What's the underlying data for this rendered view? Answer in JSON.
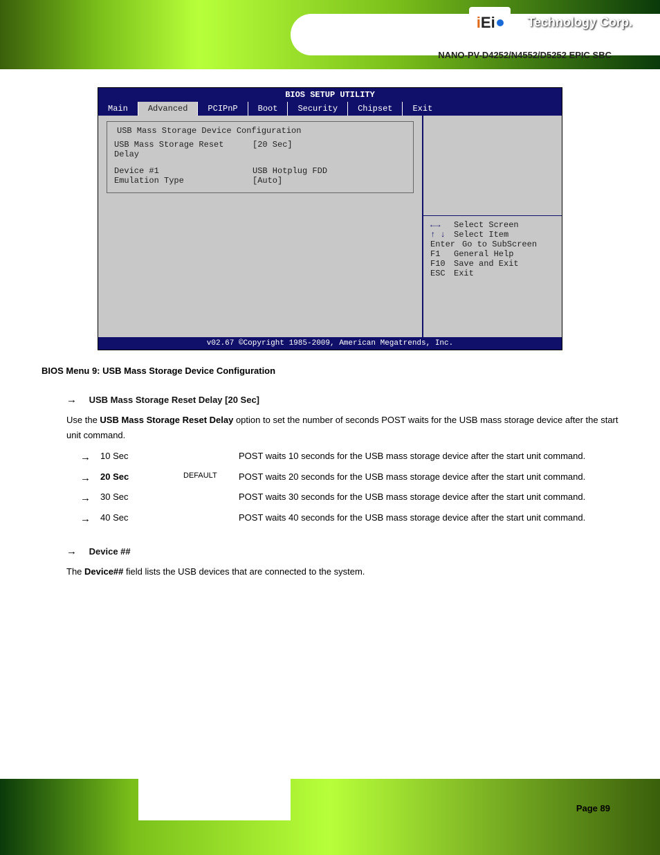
{
  "header": {
    "doc_title": "NANO-PV-D4252/N4552/D5252 EPIC SBC",
    "logo_brand": "Technology Corp.",
    "logo_mark_i1": "i",
    "logo_mark_E": "E",
    "logo_mark_i2": "i",
    "logo_reg": "®"
  },
  "bios": {
    "title": "BIOS SETUP UTILITY",
    "tabs": [
      "Main",
      "Advanced",
      "PCIPnP",
      "Boot",
      "Security",
      "Chipset",
      "Exit"
    ],
    "active_tab_index": 1,
    "sub_box_title": "USB Mass Storage Device Configuration",
    "rows": [
      {
        "k": "USB Mass Storage Reset Delay",
        "v": "[20 Sec]"
      },
      {
        "k": "",
        "v": ""
      },
      {
        "k": "Device #1",
        "v": "USB Hotplug FDD"
      },
      {
        "k": "Emulation Type",
        "v": "[Auto]"
      }
    ],
    "side_help": "",
    "keys": [
      {
        "sym": "←→",
        "txt": "Select Screen"
      },
      {
        "sym": "↑ ↓",
        "txt": "Select Item"
      },
      {
        "sym": "Enter",
        "txt": "Go to SubScreen"
      },
      {
        "sym": "F1",
        "txt": "General Help"
      },
      {
        "sym": "F10",
        "txt": "Save and Exit"
      },
      {
        "sym": "ESC",
        "txt": "Exit"
      }
    ],
    "footer": "v02.67 ©Copyright 1985-2009, American Megatrends, Inc."
  },
  "menu_label": "BIOS Menu 9: USB Mass Storage Device Configuration",
  "option1": {
    "title_prefix": "→",
    "title": "USB Mass Storage Reset Delay [20 Sec]",
    "desc_1": "Use the ",
    "desc_bold": "USB Mass Storage Reset Delay",
    "desc_2": " option to set the number of seconds POST waits for the USB mass storage device after the start unit command.",
    "choices": [
      {
        "name": "10 Sec",
        "default": "",
        "desc": "POST waits 10 seconds for the USB mass storage device after the start unit command."
      },
      {
        "name": "20 Sec",
        "default": "DEFAULT",
        "desc": "POST waits 20 seconds for the USB mass storage device after the start unit command."
      },
      {
        "name": "30 Sec",
        "default": "",
        "desc": "POST waits 30 seconds for the USB mass storage device after the start unit command."
      },
      {
        "name": "40 Sec",
        "default": "",
        "desc": "POST waits 40 seconds for the USB mass storage device after the start unit command."
      }
    ]
  },
  "option2": {
    "title": "Device ##",
    "desc_1": "The ",
    "desc_bold": "Device##",
    "desc_2": " field lists the USB devices that are connected to the system."
  },
  "page_number": "Page 89"
}
